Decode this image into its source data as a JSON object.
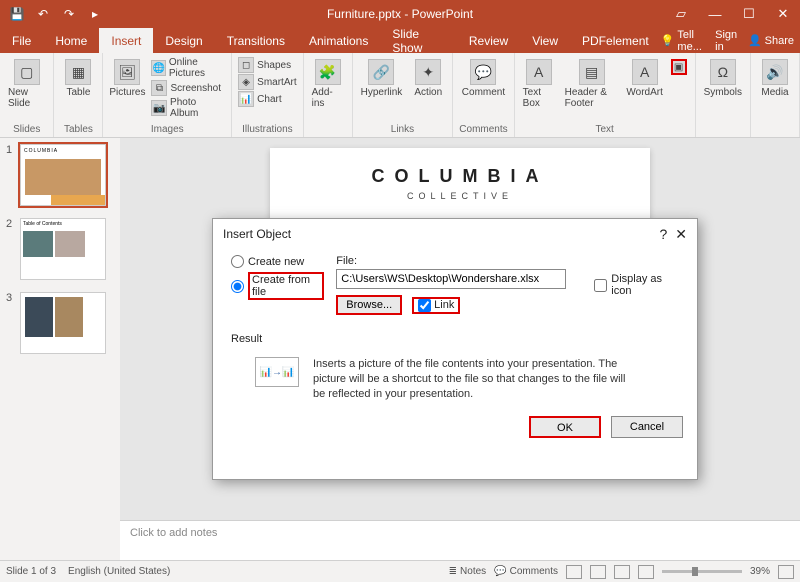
{
  "appTitle": "Furniture.pptx - PowerPoint",
  "menuTabs": [
    "File",
    "Home",
    "Insert",
    "Design",
    "Transitions",
    "Animations",
    "Slide Show",
    "Review",
    "View",
    "PDFelement"
  ],
  "menuActiveIndex": 2,
  "tellMe": "Tell me...",
  "signIn": "Sign in",
  "share": "Share",
  "ribbon": {
    "slides": {
      "newSlide": "New Slide",
      "label": "Slides"
    },
    "tables": {
      "table": "Table",
      "label": "Tables"
    },
    "images": {
      "pictures": "Pictures",
      "online": "Online Pictures",
      "screenshot": "Screenshot",
      "photoAlbum": "Photo Album",
      "label": "Images"
    },
    "illustrations": {
      "shapes": "Shapes",
      "smartart": "SmartArt",
      "chart": "Chart",
      "label": "Illustrations"
    },
    "addins": {
      "btn": "Add-ins",
      "label": ""
    },
    "links": {
      "hyperlink": "Hyperlink",
      "action": "Action",
      "label": "Links"
    },
    "comments": {
      "btn": "Comment",
      "label": "Comments"
    },
    "text": {
      "textbox": "Text Box",
      "headerfooter": "Header & Footer",
      "wordart": "WordArt",
      "label": "Text"
    },
    "symbols": {
      "btn": "Symbols",
      "label": ""
    },
    "media": {
      "btn": "Media",
      "label": ""
    }
  },
  "thumbs": [
    1,
    2,
    3
  ],
  "slideTitle": "COLUMBIA",
  "slideSub": "COLLECTIVE",
  "notesPlaceholder": "Click to add notes",
  "status": {
    "slide": "Slide 1 of 3",
    "lang": "English (United States)",
    "notes": "Notes",
    "comments": "Comments",
    "zoom": "39%"
  },
  "dialog": {
    "title": "Insert Object",
    "createNew": "Create new",
    "createFromFile": "Create from file",
    "fileLabel": "File:",
    "filePath": "C:\\Users\\WS\\Desktop\\Wondershare.xlsx",
    "browse": "Browse...",
    "linkChk": "Link",
    "displayIcon": "Display as icon",
    "resultLabel": "Result",
    "resultText": "Inserts a picture of the file contents into your presentation. The picture will be a shortcut to the file so that changes to the file will be reflected in your presentation.",
    "ok": "OK",
    "cancel": "Cancel"
  }
}
